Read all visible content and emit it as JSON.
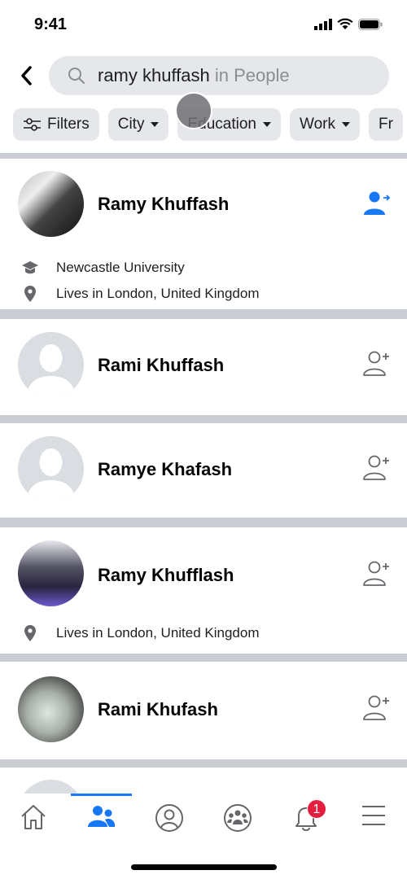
{
  "status": {
    "time": "9:41"
  },
  "search": {
    "query": "ramy khuffash",
    "scope": " in People"
  },
  "filters": [
    {
      "label": "Filters"
    },
    {
      "label": "City"
    },
    {
      "label": "Education"
    },
    {
      "label": "Work"
    },
    {
      "label": "Fr"
    }
  ],
  "results": [
    {
      "name": "Ramy Khuffash",
      "education": "Newcastle University",
      "location": "Lives in London, United Kingdom",
      "action": "friend-request-sent-icon"
    },
    {
      "name": "Rami Khuffash",
      "action": "add-friend-icon"
    },
    {
      "name": "Ramye Khafash",
      "action": "add-friend-icon"
    },
    {
      "name": "Ramy Khufflash",
      "location": "Lives in London, United Kingdom",
      "action": "add-friend-icon"
    },
    {
      "name": "Rami Khufash",
      "action": "add-friend-icon"
    }
  ],
  "tabbar": {
    "active": "friends",
    "notifications_badge": "1"
  },
  "colors": {
    "accent": "#1877f2",
    "badge": "#e41e3f"
  }
}
